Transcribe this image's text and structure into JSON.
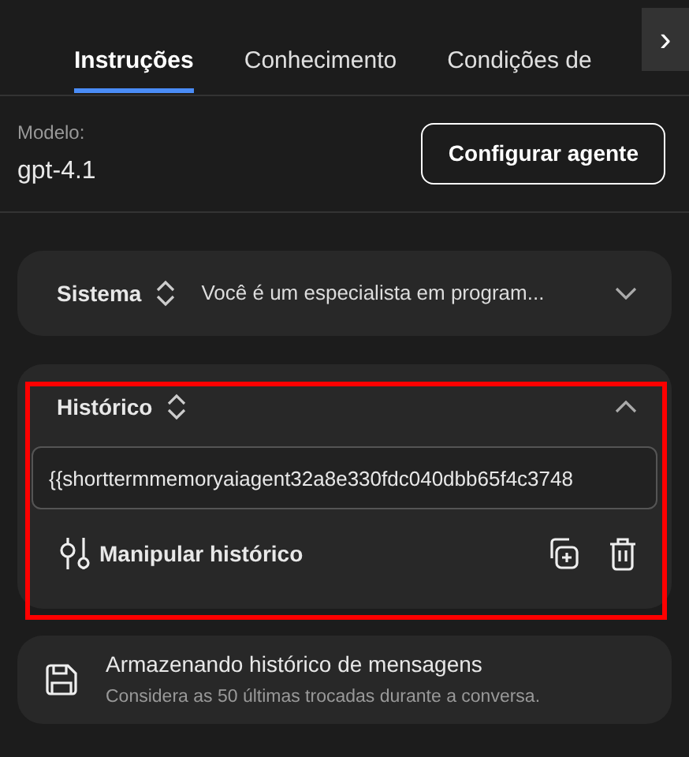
{
  "tabs": [
    {
      "label": "Instruções",
      "selected": true
    },
    {
      "label": "Conhecimento",
      "selected": false
    },
    {
      "label": "Condições de",
      "selected": false
    }
  ],
  "tabs_next": "›",
  "model": {
    "label": "Modelo:",
    "value": "gpt-4.1"
  },
  "configure_button": "Configurar agente",
  "system": {
    "title": "Sistema",
    "preview": "Você é um especialista em program...",
    "expanded": false
  },
  "history": {
    "title": "Histórico",
    "expanded": true,
    "highlighted": true,
    "value": "{{shorttermmemoryaiagent32a8e330fdc040dbb65f4c3748",
    "action": "Manipular histórico"
  },
  "storage": {
    "title": "Armazenando histórico de mensagens",
    "description": "Considera as 50 últimas trocadas durante a conversa."
  }
}
